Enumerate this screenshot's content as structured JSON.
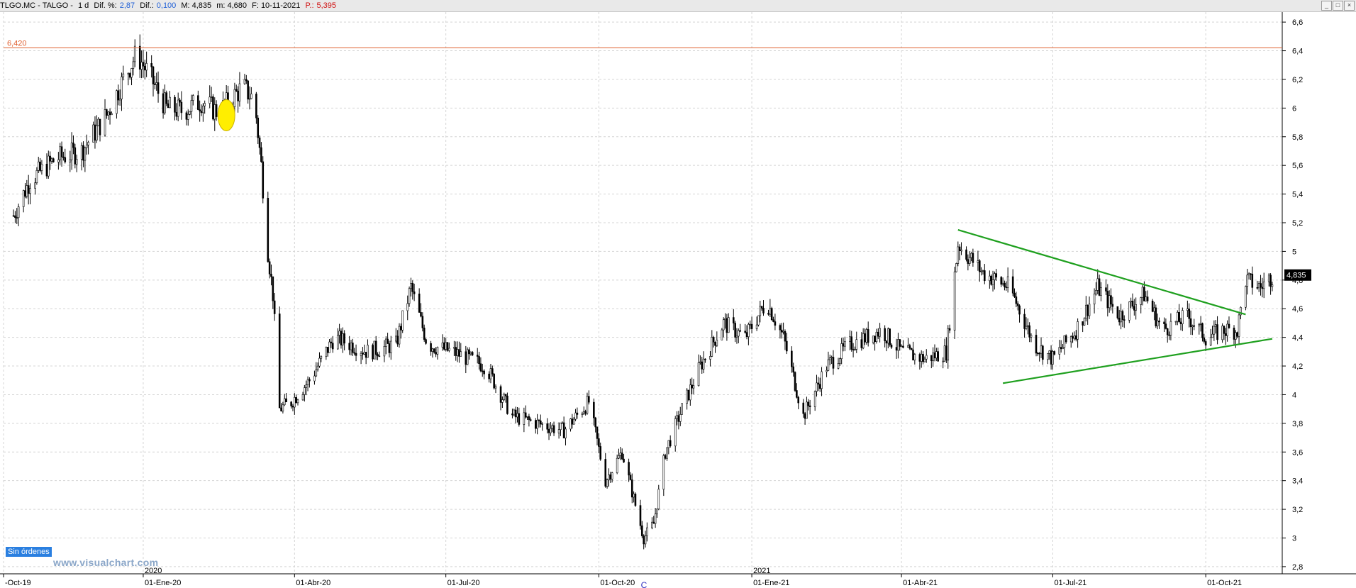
{
  "header": {
    "symbol": "TLGO.MC - TALGO -",
    "timeframe": "1 d",
    "pct_label": "Dif. %:",
    "pct_value": "2,87",
    "dif_label": "Dif.:",
    "dif_value": "0,100",
    "max_label": "M: 4,835",
    "min_label": "m: 4,680",
    "date_label": "F: 10-11-2021",
    "p_label": "P.:",
    "p_value": "5,395"
  },
  "window_buttons": [
    "_",
    "□",
    "×"
  ],
  "orders_badge": "Sin órdenes",
  "watermark": "www.visualchart.com",
  "colors": {
    "candles": "#000000",
    "trendlines": "#1fa01f",
    "resistance_line": "#e06030",
    "highlight": "#ffee00",
    "last_price_bg": "#000000"
  },
  "chart_data": {
    "type": "candlestick",
    "ylim": [
      2.75,
      6.67
    ],
    "date_range": [
      "2019-10-15",
      "2021-11-10"
    ],
    "y_ticks": [
      2.8,
      3,
      3.2,
      3.4,
      3.6,
      3.8,
      4,
      4.2,
      4.4,
      4.6,
      4.8,
      5,
      5.2,
      5.4,
      5.6,
      5.8,
      6,
      6.2,
      6.4,
      6.6
    ],
    "y_tick_labels": [
      "2,8",
      "3",
      "3,2",
      "3,4",
      "3,6",
      "3,8",
      "4",
      "4,2",
      "4,4",
      "4,6",
      "4,8",
      "5",
      "5,2",
      "5,4",
      "5,6",
      "5,8",
      "6",
      "6,2",
      "6,4",
      "6,6"
    ],
    "x_ticks": [
      {
        "date": "2019-10-01",
        "label": "-Oct-19"
      },
      {
        "date": "2020-01-01",
        "label": "01-Ene-20"
      },
      {
        "date": "2020-04-01",
        "label": "01-Abr-20"
      },
      {
        "date": "2020-07-01",
        "label": "01-Jul-20"
      },
      {
        "date": "2020-10-01",
        "label": "01-Oct-20"
      },
      {
        "date": "2021-01-01",
        "label": "01-Ene-21"
      },
      {
        "date": "2021-04-01",
        "label": "01-Abr-21"
      },
      {
        "date": "2021-07-01",
        "label": "01-Jul-21"
      },
      {
        "date": "2021-10-01",
        "label": "01-Oct-21"
      }
    ],
    "year_markers": [
      {
        "date": "2020-01-01",
        "label": "2020"
      },
      {
        "date": "2021-01-01",
        "label": "2021"
      }
    ],
    "grid": true,
    "resistance": {
      "value": 6.42,
      "label": "6,420"
    },
    "last_price": {
      "value": 4.835,
      "label": "4,835"
    },
    "trendlines": [
      {
        "from": {
          "date": "2021-05-05",
          "value": 5.15
        },
        "to": {
          "date": "2021-10-25",
          "value": 4.56
        }
      },
      {
        "from": {
          "date": "2021-06-01",
          "value": 4.08
        },
        "to": {
          "date": "2021-11-10",
          "value": 4.39
        }
      }
    ],
    "highlight": {
      "date": "2020-02-20",
      "value": 5.95
    },
    "annotations": [
      {
        "date": "2020-10-28",
        "value": 2.85,
        "text": "C"
      }
    ],
    "series_points": [
      [
        "2019-10-15",
        5.25
      ],
      [
        "2019-10-25",
        5.5
      ],
      [
        "2019-11-10",
        5.65
      ],
      [
        "2019-11-25",
        5.7
      ],
      [
        "2019-12-10",
        5.95
      ],
      [
        "2019-12-20",
        6.2
      ],
      [
        "2019-12-28",
        6.38
      ],
      [
        "2020-01-06",
        6.2
      ],
      [
        "2020-01-15",
        6.0
      ],
      [
        "2020-01-25",
        5.98
      ],
      [
        "2020-02-05",
        6.05
      ],
      [
        "2020-02-15",
        5.97
      ],
      [
        "2020-02-22",
        6.05
      ],
      [
        "2020-03-01",
        6.15
      ],
      [
        "2020-03-08",
        6.05
      ],
      [
        "2020-03-12",
        5.6
      ],
      [
        "2020-03-16",
        5.0
      ],
      [
        "2020-03-19",
        4.7
      ],
      [
        "2020-03-23",
        3.9
      ],
      [
        "2020-03-30",
        3.95
      ],
      [
        "2020-04-10",
        4.1
      ],
      [
        "2020-04-25",
        4.4
      ],
      [
        "2020-05-15",
        4.3
      ],
      [
        "2020-06-01",
        4.35
      ],
      [
        "2020-06-10",
        4.75
      ],
      [
        "2020-06-20",
        4.35
      ],
      [
        "2020-07-05",
        4.3
      ],
      [
        "2020-07-25",
        4.2
      ],
      [
        "2020-08-10",
        3.85
      ],
      [
        "2020-08-25",
        3.8
      ],
      [
        "2020-09-10",
        3.75
      ],
      [
        "2020-09-25",
        3.95
      ],
      [
        "2020-10-05",
        3.4
      ],
      [
        "2020-10-15",
        3.6
      ],
      [
        "2020-10-28",
        3.0
      ],
      [
        "2020-11-03",
        3.1
      ],
      [
        "2020-11-10",
        3.6
      ],
      [
        "2020-11-20",
        3.9
      ],
      [
        "2020-12-01",
        4.2
      ],
      [
        "2020-12-15",
        4.5
      ],
      [
        "2020-12-28",
        4.4
      ],
      [
        "2021-01-10",
        4.65
      ],
      [
        "2021-01-20",
        4.4
      ],
      [
        "2021-02-01",
        3.85
      ],
      [
        "2021-02-15",
        4.2
      ],
      [
        "2021-03-01",
        4.35
      ],
      [
        "2021-03-20",
        4.45
      ],
      [
        "2021-04-01",
        4.3
      ],
      [
        "2021-04-15",
        4.25
      ],
      [
        "2021-04-28",
        4.3
      ],
      [
        "2021-05-05",
        5.05
      ],
      [
        "2021-05-20",
        4.85
      ],
      [
        "2021-06-05",
        4.75
      ],
      [
        "2021-06-20",
        4.35
      ],
      [
        "2021-07-01",
        4.25
      ],
      [
        "2021-07-15",
        4.45
      ],
      [
        "2021-07-28",
        4.75
      ],
      [
        "2021-08-10",
        4.55
      ],
      [
        "2021-08-25",
        4.7
      ],
      [
        "2021-09-05",
        4.45
      ],
      [
        "2021-09-20",
        4.55
      ],
      [
        "2021-10-01",
        4.4
      ],
      [
        "2021-10-12",
        4.45
      ],
      [
        "2021-10-20",
        4.45
      ],
      [
        "2021-10-25",
        4.8
      ],
      [
        "2021-11-03",
        4.75
      ],
      [
        "2021-11-10",
        4.83
      ]
    ]
  }
}
